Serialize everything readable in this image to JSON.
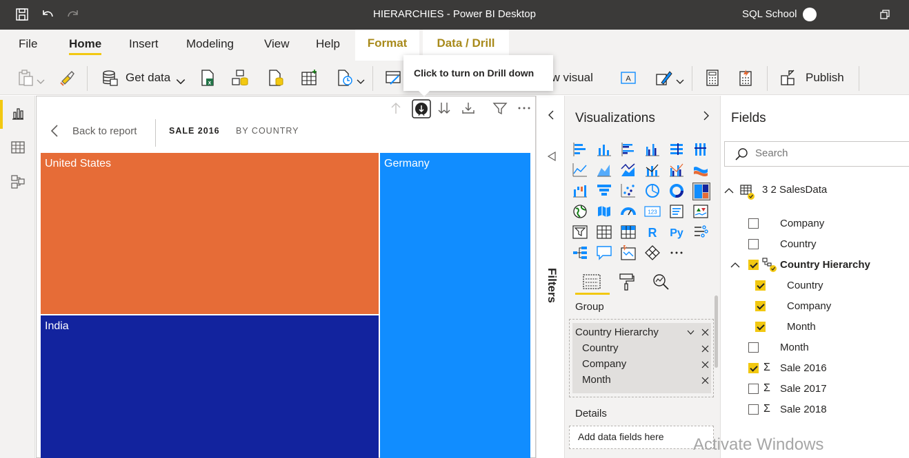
{
  "window": {
    "title": "HIERARCHIES - Power BI Desktop",
    "user": "SQL School"
  },
  "ribbon": {
    "tabs": [
      "File",
      "Home",
      "Insert",
      "Modeling",
      "View",
      "Help"
    ],
    "active": "Home",
    "context_tabs": [
      "Format",
      "Data / Drill"
    ]
  },
  "toolbar": {
    "get_data": "Get data",
    "new_visual": "New visual",
    "publish": "Publish"
  },
  "tooltip": {
    "text": "Click to turn on Drill down"
  },
  "visual": {
    "back": "Back to report",
    "crumbs": [
      "SALE 2016",
      "BY COUNTRY"
    ],
    "tiles": [
      {
        "label": "United States",
        "color": "#e66c37"
      },
      {
        "label": "Germany",
        "color": "#118dff"
      },
      {
        "label": "India",
        "color": "#12239e"
      }
    ]
  },
  "filters": {
    "label": "Filters"
  },
  "visualizations": {
    "title": "Visualizations",
    "group_label": "Group",
    "hierarchy": {
      "name": "Country Hierarchy",
      "levels": [
        "Country",
        "Company",
        "Month"
      ]
    },
    "details_label": "Details",
    "details_placeholder": "Add data fields here"
  },
  "fields": {
    "title": "Fields",
    "search_placeholder": "Search",
    "table": "3 2 SalesData",
    "items": [
      {
        "label": "Company",
        "checked": false,
        "sigma": false
      },
      {
        "label": "Country",
        "checked": false,
        "sigma": false
      },
      {
        "label": "Country Hierarchy",
        "checked": true,
        "sigma": false,
        "hierarchy": true
      },
      {
        "label": "Country",
        "checked": true,
        "sigma": false,
        "child": true
      },
      {
        "label": "Company",
        "checked": true,
        "sigma": false,
        "child": true
      },
      {
        "label": "Month",
        "checked": true,
        "sigma": false,
        "child": true
      },
      {
        "label": "Month",
        "checked": false,
        "sigma": false
      },
      {
        "label": "Sale 2016",
        "checked": true,
        "sigma": true
      },
      {
        "label": "Sale 2017",
        "checked": false,
        "sigma": true
      },
      {
        "label": "Sale 2018",
        "checked": false,
        "sigma": true
      }
    ]
  },
  "watermark": "Activate Windows"
}
